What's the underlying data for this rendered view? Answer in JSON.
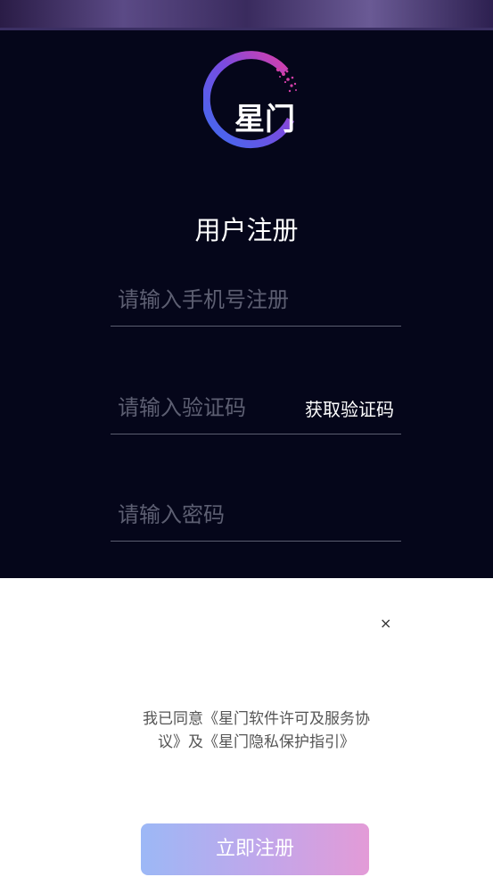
{
  "logo": {
    "text": "星门"
  },
  "form": {
    "title": "用户注册",
    "phone_placeholder": "请输入手机号注册",
    "code_placeholder": "请输入验证码",
    "get_code_label": "获取验证码",
    "password_placeholder": "请输入密码"
  },
  "dialog": {
    "close_label": "×",
    "agreement_text": "我已同意《星门软件许可及服务协议》及《星门隐私保护指引》",
    "register_label": "立即注册"
  },
  "colors": {
    "background_dark": "#05061a",
    "accent_pink": "#d13fa8",
    "accent_blue": "#4a64e8",
    "button_gradient_start": "#9cb8f6",
    "button_gradient_end": "#e39bd7"
  }
}
